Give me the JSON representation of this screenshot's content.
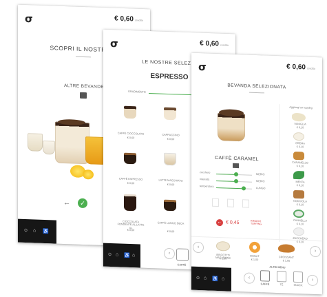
{
  "brand": {
    "logo_glyph": "σ"
  },
  "credit": {
    "amount": "€ 0,60",
    "label": "credito"
  },
  "screen1": {
    "title": "SCOPRI IL NOSTRO M",
    "subtitle": "ALTRE BEVANDE",
    "back_glyph": "←",
    "confirm_glyph": "✓",
    "footer_icons": [
      "☺",
      "⌂",
      "♿"
    ]
  },
  "screen2": {
    "title": "LE NOSTRE SELEZIO",
    "selected": "ESPRESSO",
    "slider_label": "GRADIMENTO",
    "products": [
      {
        "name": "CAFFÈ CIOCCOLATO",
        "price": "€ 0,60"
      },
      {
        "name": "CAPPUCCINO",
        "price": "€ 0,60"
      },
      {
        "name": "CAFFÈ ESPRESSO",
        "price": "€ 0,60"
      },
      {
        "name": "LATTE MACCHIATO",
        "price": "€ 0,60"
      },
      {
        "name": "CIOCCOLATA FONDENTE AL LATTE XL",
        "price": "€ 0,60"
      },
      {
        "name": "CAFFÈ LUNGO DECA",
        "price": "€ 0,60"
      }
    ],
    "bottom_label": "CAFFÈ"
  },
  "screen3": {
    "title": "BEVANDA SELEZIONATA",
    "side_title": "Aggiungi un topping",
    "product_name": "CAFFÈ CARAMEL",
    "controls": [
      {
        "label": "zucchero",
        "value": "MEDIO",
        "level": 0.55
      },
      {
        "label": "intensità",
        "value": "MEDIO",
        "level": 0.55
      },
      {
        "label": "temperatura",
        "value": "LUNGO",
        "level": 0.75
      }
    ],
    "price": "€ 0,45",
    "action_label": "RIMUOVI TOPPING",
    "toppings": [
      {
        "name": "VANIGLIA",
        "price": "€ 0,10"
      },
      {
        "name": "CREMA",
        "price": "€ 0,10"
      },
      {
        "name": "CARAMELLO",
        "price": "€ 0,10"
      },
      {
        "name": "MENTA",
        "price": "€ 0,10"
      },
      {
        "name": "NOCCIOLA",
        "price": "€ 0,10"
      },
      {
        "name": "CANNELLA",
        "price": "€ 0,10"
      },
      {
        "name": "ZUCCHERO",
        "price": "€ 0,10"
      }
    ],
    "snacks": [
      {
        "name": "BISCOTTO MACARONS",
        "price": "€ 1,00"
      },
      {
        "name": "DONUT",
        "price": "€ 1,00"
      },
      {
        "name": "CROISSANT",
        "price": "€ 1,00"
      }
    ],
    "more_label": "ALTRI MENU",
    "bottom_tabs": [
      "CAFFÈ",
      "TÈ",
      "SNACK"
    ]
  },
  "colors": {
    "accent_green": "#4caf50",
    "accent_red": "#d84040",
    "footer_bg": "#161616"
  }
}
